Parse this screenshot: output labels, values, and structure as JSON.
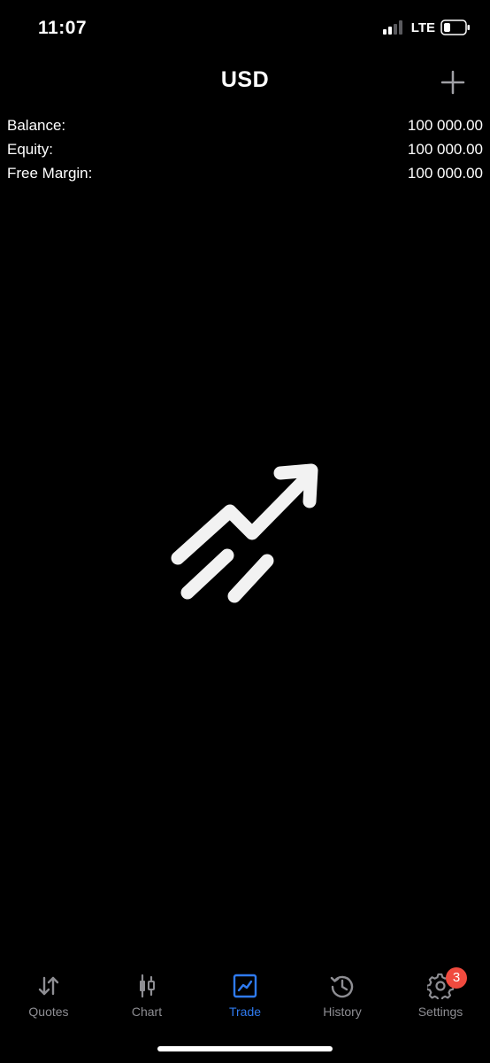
{
  "status_bar": {
    "time": "11:07",
    "network": "LTE"
  },
  "header": {
    "title": "USD"
  },
  "account": {
    "rows": [
      {
        "label": "Balance:",
        "value": "100 000.00"
      },
      {
        "label": "Equity:",
        "value": "100 000.00"
      },
      {
        "label": "Free Margin:",
        "value": "100 000.00"
      }
    ]
  },
  "tab_bar": {
    "tabs": [
      {
        "label": "Quotes",
        "icon": "quotes-arrows-icon"
      },
      {
        "label": "Chart",
        "icon": "candlestick-icon"
      },
      {
        "label": "Trade",
        "icon": "trade-chart-icon"
      },
      {
        "label": "History",
        "icon": "history-clock-icon"
      },
      {
        "label": "Settings",
        "icon": "gear-icon",
        "badge": "3"
      }
    ],
    "active_tab": "Trade"
  },
  "colors": {
    "background": "#000000",
    "accent": "#2f7bf1",
    "inactive": "#8e8e93",
    "badge": "#f04a3e"
  }
}
